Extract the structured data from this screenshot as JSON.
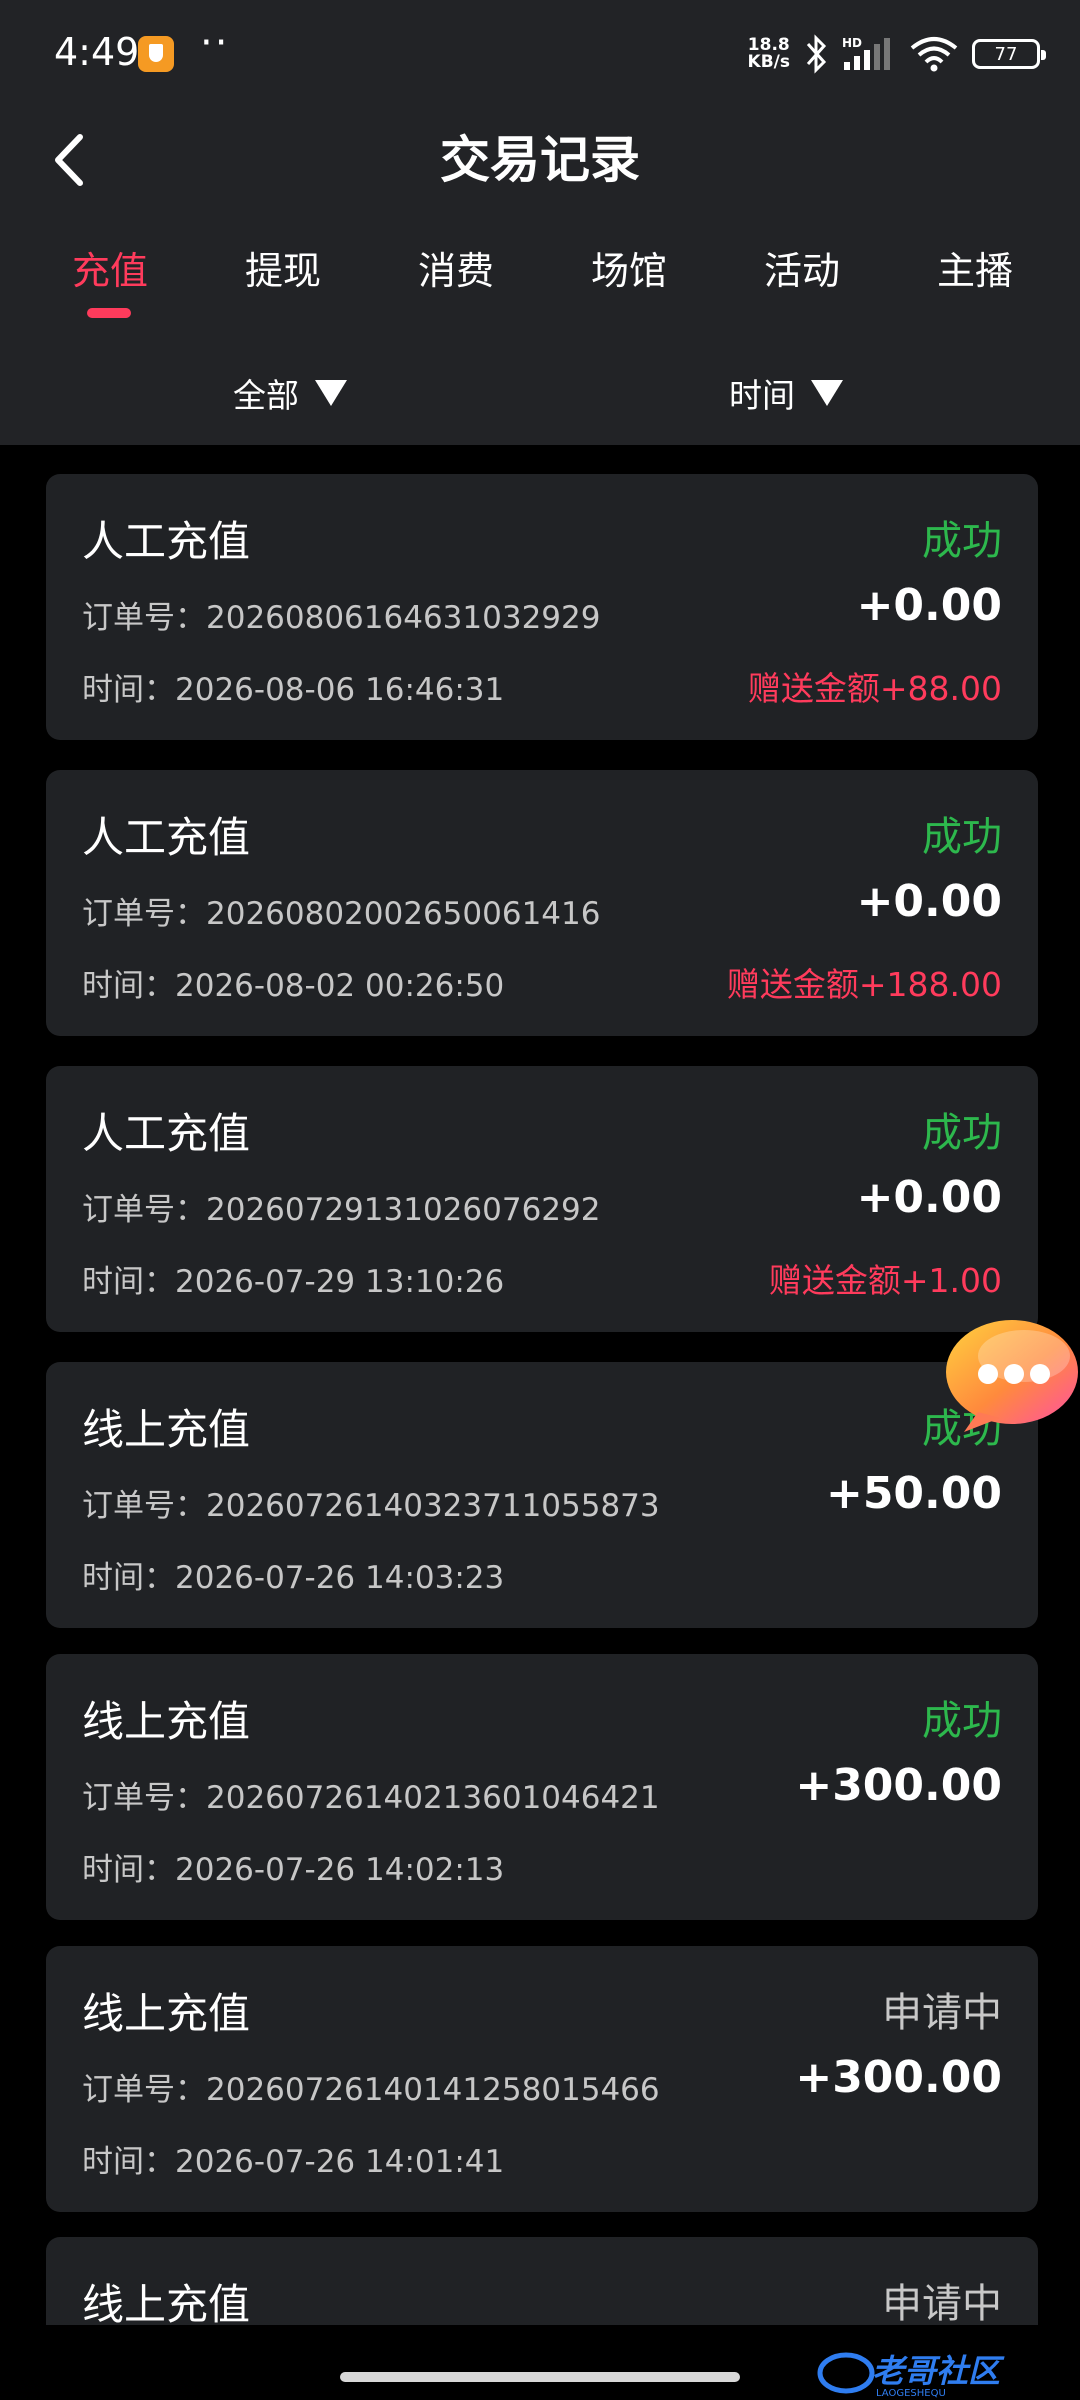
{
  "status_bar": {
    "time": "4:49",
    "dots": "··",
    "speed_value": "18.8",
    "speed_unit": "KB/s",
    "battery": "77",
    "network_badge": "HD"
  },
  "header": {
    "title": "交易记录"
  },
  "tabs": [
    {
      "label": "充值",
      "active": true
    },
    {
      "label": "提现",
      "active": false
    },
    {
      "label": "消费",
      "active": false
    },
    {
      "label": "场馆",
      "active": false
    },
    {
      "label": "活动",
      "active": false
    },
    {
      "label": "主播",
      "active": false
    }
  ],
  "filters": {
    "category_label": "全部",
    "time_label": "时间"
  },
  "records": [
    {
      "type": "人工充值",
      "status": "成功",
      "order": "订单号：20260806164631032929",
      "amount": "+0.00",
      "time": "时间：2026-08-06 16:46:31",
      "bonus": "赠送金额+88.00"
    },
    {
      "type": "人工充值",
      "status": "成功",
      "order": "订单号：20260802002650061416",
      "amount": "+0.00",
      "time": "时间：2026-08-02 00:26:50",
      "bonus": "赠送金额+188.00"
    },
    {
      "type": "人工充值",
      "status": "成功",
      "order": "订单号：20260729131026076292",
      "amount": "+0.00",
      "time": "时间：2026-07-29 13:10:26",
      "bonus": "赠送金额+1.00"
    },
    {
      "type": "线上充值",
      "status": "成功",
      "order": "订单号：20260726140323711055873",
      "amount": "+50.00",
      "time": "时间：2026-07-26 14:03:23",
      "bonus": ""
    },
    {
      "type": "线上充值",
      "status": "成功",
      "order": "订单号：20260726140213601046421",
      "amount": "+300.00",
      "time": "时间：2026-07-26 14:02:13",
      "bonus": ""
    },
    {
      "type": "线上充值",
      "status": "申请中",
      "order": "订单号：20260726140141258015466",
      "amount": "+300.00",
      "time": "时间：2026-07-26 14:01:41",
      "bonus": ""
    },
    {
      "type": "线上充值",
      "status": "申请中",
      "order": "",
      "amount": "",
      "time": "",
      "bonus": ""
    }
  ],
  "watermark": {
    "text": "老哥社区",
    "subtext": "LAOGESHEQU"
  },
  "colors": {
    "accent": "#ff3b5c",
    "success": "#2db84d",
    "pending": "#c8c8c8",
    "panel": "#222326",
    "card": "#202225",
    "background": "#000000"
  },
  "icons": {
    "back": "chevron-left-icon",
    "dropdown": "triangle-down-icon",
    "chat": "chat-bubble-icon",
    "bluetooth": "bluetooth-icon",
    "wifi": "wifi-icon",
    "signal": "signal-icon",
    "battery": "battery-icon",
    "shield": "shield-icon"
  }
}
